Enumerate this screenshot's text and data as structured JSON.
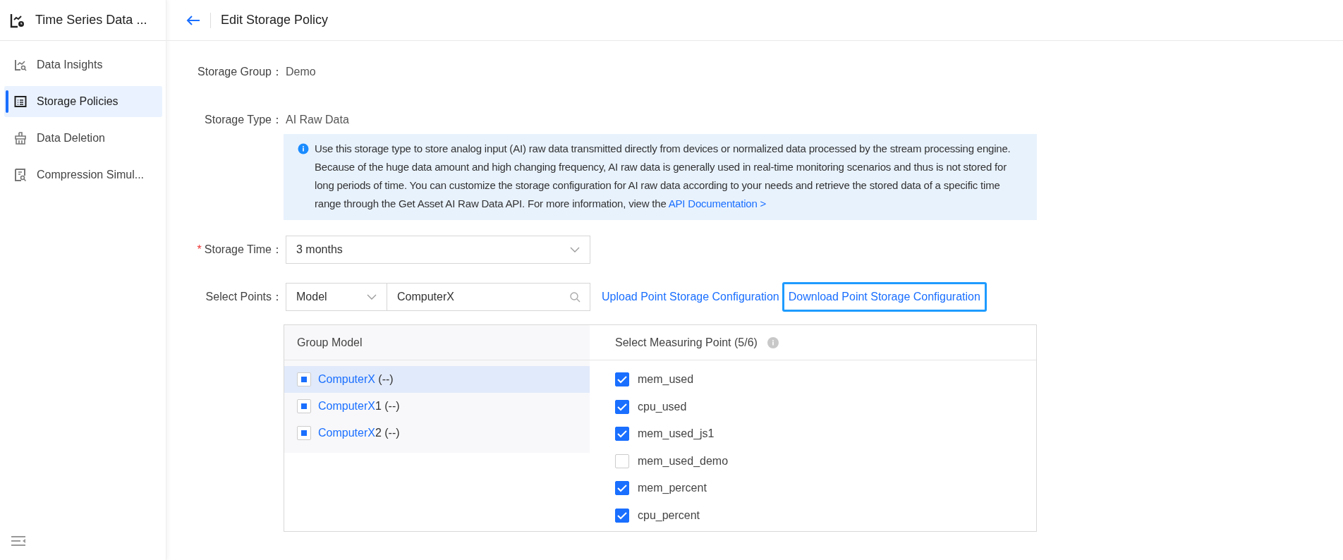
{
  "sidebar": {
    "app_title": "Time Series Data ...",
    "items": [
      {
        "label": "Data Insights",
        "selected": false
      },
      {
        "label": "Storage Policies",
        "selected": true
      },
      {
        "label": "Data Deletion",
        "selected": false
      },
      {
        "label": "Compression Simul...",
        "selected": false
      }
    ]
  },
  "header": {
    "title": "Edit Storage Policy"
  },
  "form": {
    "storage_group": {
      "label": "Storage Group：",
      "value": "Demo"
    },
    "storage_type": {
      "label": "Storage Type：",
      "value": "AI Raw Data"
    },
    "info": {
      "text": "Use this storage type to store analog input (AI) raw data transmitted directly from devices or normalized data processed by the stream processing engine. Because of the huge data amount and high changing frequency, AI raw data is generally used in real-time monitoring scenarios and thus is not stored for long periods of time. You can customize the storage configuration for AI raw data according to your needs and retrieve the stored data of a specific time range through the Get Asset AI Raw Data API. For more information, view the",
      "link": "API Documentation >"
    },
    "storage_time": {
      "required_mark": "*",
      "label": "Storage Time：",
      "value": "3 months"
    },
    "select_points": {
      "label": "Select Points：",
      "filter": "Model",
      "search": "ComputerX",
      "upload": "Upload Point Storage Configuration",
      "download": "Download Point Storage Configuration"
    }
  },
  "transfer": {
    "left_title": "Group Model",
    "right_title": "Select Measuring Point (5/6)",
    "models": [
      {
        "match": "ComputerX",
        "rest": " (--)",
        "indeterminate": true,
        "selected": true
      },
      {
        "match": "ComputerX",
        "rest": "1 (--)",
        "indeterminate": true,
        "selected": false
      },
      {
        "match": "ComputerX",
        "rest": "2 (--)",
        "indeterminate": true,
        "selected": false
      }
    ],
    "points": [
      {
        "label": "mem_used",
        "checked": true
      },
      {
        "label": "cpu_used",
        "checked": true
      },
      {
        "label": "mem_used_js1",
        "checked": true
      },
      {
        "label": "mem_used_demo",
        "checked": false
      },
      {
        "label": "mem_percent",
        "checked": true
      },
      {
        "label": "cpu_percent",
        "checked": true
      }
    ]
  }
}
